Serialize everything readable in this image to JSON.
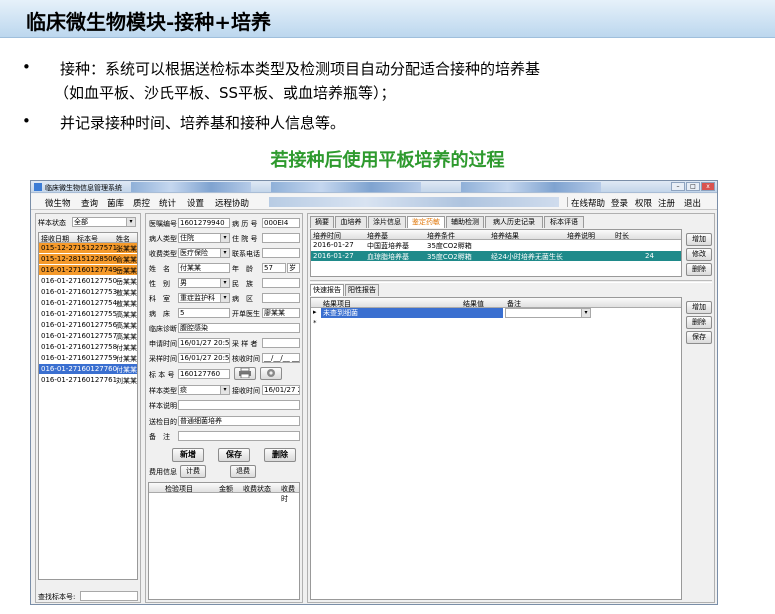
{
  "slide": {
    "title": "临床微生物模块-接种+培养",
    "bullet1a": "接种：系统可以根据送检标本类型及检测项目自动分配适合接种的培养基",
    "bullet1b": "（如血平板、沙氏平板、SS平板、或血培养瓶等）；",
    "bullet2": "并记录接种时间、培养基和接种人信息等。",
    "subtitle": "若接种后使用平板培养的过程",
    "bullet_char": "•"
  },
  "window": {
    "title": "临床微生物信息管理系统",
    "min": "–",
    "max": "□",
    "close": "x",
    "menu": [
      "微生物",
      "查询",
      "菌库",
      "质控",
      "统计",
      "设置",
      "远程协助"
    ],
    "menu_right": [
      "在线帮助",
      "登录",
      "权限",
      "注册",
      "退出"
    ]
  },
  "left": {
    "status_label": "样本状态",
    "status_value": "全部",
    "headers": [
      "接收日期",
      "标本号",
      "姓名"
    ],
    "rows": [
      {
        "date": "015-12-27",
        "id": "151227571",
        "name": "张某某",
        "style": "orange"
      },
      {
        "date": "015-12-28",
        "id": "151228506",
        "name": "俞某某",
        "style": "orange"
      },
      {
        "date": "016-01-27",
        "id": "160127749",
        "name": "岳某某",
        "style": "orange"
      },
      {
        "date": "016-01-27",
        "id": "160127750",
        "name": "岳某某",
        "style": ""
      },
      {
        "date": "016-01-27",
        "id": "160127753",
        "name": "敖某某",
        "style": ""
      },
      {
        "date": "016-01-27",
        "id": "160127754",
        "name": "敖某某",
        "style": ""
      },
      {
        "date": "016-01-27",
        "id": "160127755",
        "name": "高某某",
        "style": ""
      },
      {
        "date": "016-01-27",
        "id": "160127756",
        "name": "高某某",
        "style": ""
      },
      {
        "date": "016-01-27",
        "id": "160127757",
        "name": "高某某",
        "style": ""
      },
      {
        "date": "016-01-27",
        "id": "160127758",
        "name": "付某某",
        "style": ""
      },
      {
        "date": "016-01-27",
        "id": "160127759",
        "name": "付某某",
        "style": ""
      },
      {
        "date": "016-01-27",
        "id": "160127760",
        "name": "付某某",
        "style": "selected"
      },
      {
        "date": "016-01-27",
        "id": "160127761",
        "name": "刘某某",
        "style": ""
      }
    ],
    "search_label": "查找标本号:"
  },
  "form": {
    "f1l": "医嘱编号",
    "f1v": "1601279940",
    "f1rl": "病 历 号",
    "f1rv": "000EI4",
    "f2l": "病人类型",
    "f2v": "住院",
    "f2rl": "住 院 号",
    "f3l": "收费类型",
    "f3v": "医疗保险",
    "f3rl": "联系电话",
    "f4l": "姓　名",
    "f4v": "付某某",
    "f4rl": "年　龄",
    "f4rv": "57",
    "f4u": "岁",
    "f5l": "性　别",
    "f5v": "男",
    "f5rl": "民　族",
    "f6l": "科　室",
    "f6v": "重症监护科",
    "f6rl": "病　区",
    "f7l": "病　床",
    "f7v": "5",
    "f7rl": "开单医生",
    "f7rv": "廖某某",
    "f8l": "临床诊断",
    "f8v": "腹腔感染",
    "f9l": "申请时间",
    "f9v": "16/01/27 20:53",
    "f9rl": "采 样 者",
    "f10l": "采样时间",
    "f10v": "16/01/27 20:50",
    "f10rl": "核收时间",
    "f10rv": "__/__/__ __:__",
    "f11l": "标 本 号",
    "f11v": "160127760",
    "f12l": "样本类型",
    "f12v": "痰",
    "f12rl": "接收时间",
    "f12rv": "16/01/27 22:",
    "f13l": "样本说明",
    "f14l": "送检目的",
    "f14v": "普通细菌培养",
    "f15l": "备　注",
    "btn_new": "新增",
    "btn_save": "保存",
    "btn_delete": "删除",
    "fee_label": "费用信息",
    "fee_btn1": "计费",
    "fee_btn2": "退费",
    "fee_headers": [
      "检验项目",
      "金额",
      "收费状态",
      "收费时"
    ]
  },
  "right": {
    "tabs": [
      "摘要",
      "血培养",
      "涂片信息",
      "鉴定药敏",
      "辅助检测",
      "病人历史记录",
      "标本评语"
    ],
    "culture_headers": [
      "培养时间",
      "培养基",
      "培养条件",
      "培养结果",
      "培养说明",
      "时长"
    ],
    "culture_rows": [
      {
        "time": "2016-01-27",
        "medium": "中国蓝培养基",
        "cond": "35度CO2孵箱",
        "result": "",
        "note": "",
        "dur": "",
        "sel": false
      },
      {
        "time": "2016-01-27",
        "medium": "血琼脂培养基",
        "cond": "35度CO2孵箱",
        "result": "经24小时培养无菌生长",
        "note": "",
        "dur": "24",
        "sel": true
      }
    ],
    "btns_top": [
      "增加",
      "修改",
      "删除"
    ],
    "report_tabs": [
      "快速报告",
      "阳性报告"
    ],
    "report_headers": [
      "结果项目",
      "结果值",
      "备注"
    ],
    "report_row": {
      "item": "未查到细菌",
      "value": "",
      "note": ""
    },
    "btns_bottom": [
      "增加",
      "删除",
      "保存"
    ]
  }
}
